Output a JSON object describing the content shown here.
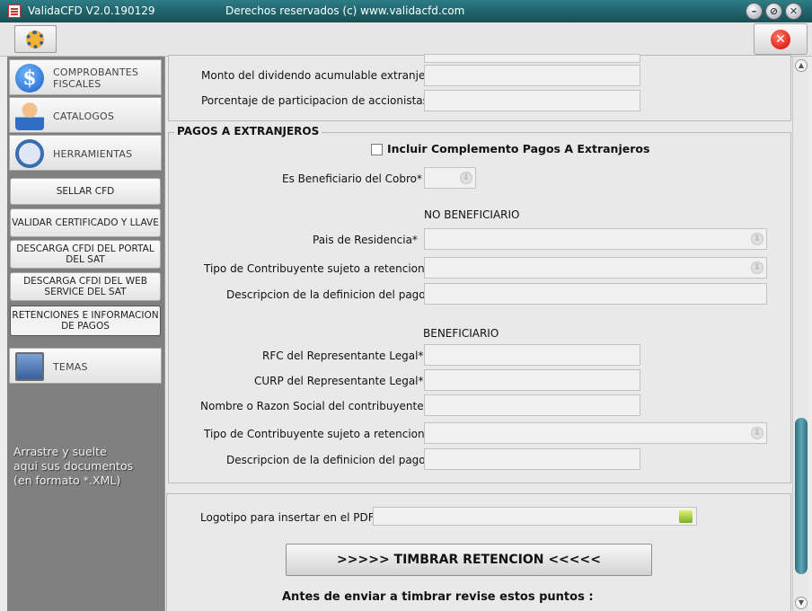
{
  "window": {
    "title": "ValidaCFD V2.0.190129",
    "center_text": "Derechos reservados (c) www.validacfd.com"
  },
  "window_controls": {
    "minimize": "–",
    "restore": "⊘",
    "close": "✕"
  },
  "toolbar": {
    "settings_icon": "gear-icon",
    "exit_icon": "close-icon",
    "exit_glyph": "✕"
  },
  "sidebar": {
    "items": [
      {
        "label": "COMPROBANTES FISCALES",
        "icon": "dollar-icon"
      },
      {
        "label": "CATALOGOS",
        "icon": "user-icon"
      },
      {
        "label": "HERRAMIENTAS",
        "icon": "tools-icon"
      },
      {
        "label": "TEMAS",
        "icon": "monitor-icon"
      }
    ],
    "tools": [
      "SELLAR CFD",
      "VALIDAR CERTIFICADO Y LLAVE",
      "DESCARGA CFDI DEL PORTAL DEL SAT",
      "DESCARGA CFDI DEL WEB SERVICE DEL SAT",
      "RETENCIONES E INFORMACION DE PAGOS"
    ],
    "drop_text": [
      "Arrastre y suelte",
      "aqui sus documentos",
      "(en formato *.XML)"
    ]
  },
  "dividendos": {
    "monto_label": "Monto del dividendo acumulable extranjero",
    "porcentaje_label": "Porcentaje de participacion de accionistas"
  },
  "pagos": {
    "legend": "PAGOS A EXTRANJEROS",
    "checkbox_label": "Incluir Complemento Pagos A Extranjeros",
    "beneficiario_label": "Es Beneficiario del Cobro*",
    "no_beneficiario_title": "NO BENEFICIARIO",
    "pais_label": "Pais de Residencia*",
    "tipo_label": "Tipo de Contribuyente sujeto a retencion*",
    "desc_label": "Descripcion de la definicion del pago*",
    "beneficiario_title": "BENEFICIARIO",
    "rfc_label": "RFC del Representante Legal*",
    "curp_label": "CURP del Representante Legal*",
    "nombre_label": "Nombre o Razon Social del contribuyente*",
    "tipo2_label": "Tipo de Contribuyente sujeto a retencion*",
    "desc2_label": "Descripcion de la definicion del pago*"
  },
  "footer": {
    "logo_label": "Logotipo para insertar en el PDF",
    "timbrar_label": ">>>>> TIMBRAR RETENCION <<<<<",
    "antes_label": "Antes de enviar a timbrar revise estos puntos :"
  },
  "scroll": {
    "up": "▲",
    "down": "▼"
  }
}
